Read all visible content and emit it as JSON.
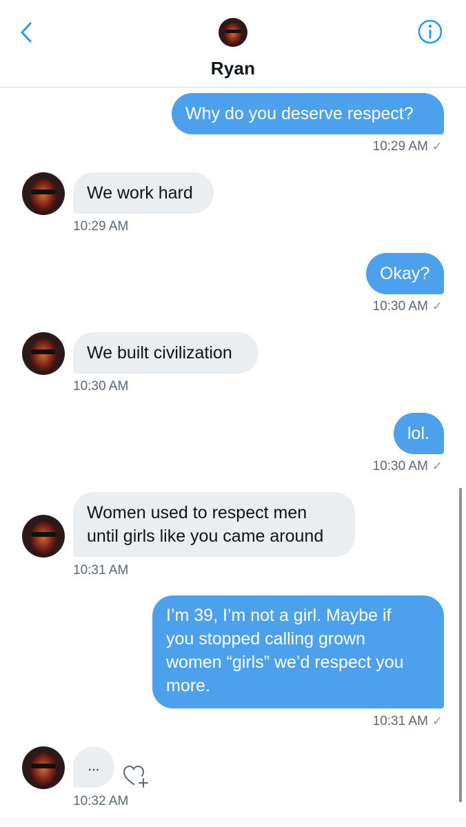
{
  "header": {
    "contact_name": "Ryan"
  },
  "colors": {
    "accent": "#1d9bf0",
    "outgoing_bubble": "#4da0eb",
    "incoming_bubble": "#ebeef0"
  },
  "messages": [
    {
      "direction": "outgoing",
      "text": "Why do you deserve respect?",
      "time": "10:29 AM",
      "status_icon": "check-icon"
    },
    {
      "direction": "incoming",
      "text": "We work hard",
      "time": "10:29 AM"
    },
    {
      "direction": "outgoing",
      "text": "Okay?",
      "time": "10:30 AM",
      "status_icon": "check-icon"
    },
    {
      "direction": "incoming",
      "text": "We built civilization",
      "time": "10:30 AM"
    },
    {
      "direction": "outgoing",
      "text": "lol.",
      "time": "10:30 AM",
      "status_icon": "check-icon"
    },
    {
      "direction": "incoming",
      "lines": [
        "Women used to respect men",
        "until girls like you came around"
      ],
      "time": "10:31 AM"
    },
    {
      "direction": "outgoing",
      "lines": [
        "I’m 39, I’m not a girl. Maybe if",
        "you stopped calling grown",
        "women “girls” we’d respect you",
        "more."
      ],
      "time": "10:31 AM",
      "status_icon": "check-icon"
    },
    {
      "direction": "incoming",
      "text": "...",
      "time": "10:32 AM",
      "reaction_icon": "add-reaction-heart-icon"
    }
  ]
}
